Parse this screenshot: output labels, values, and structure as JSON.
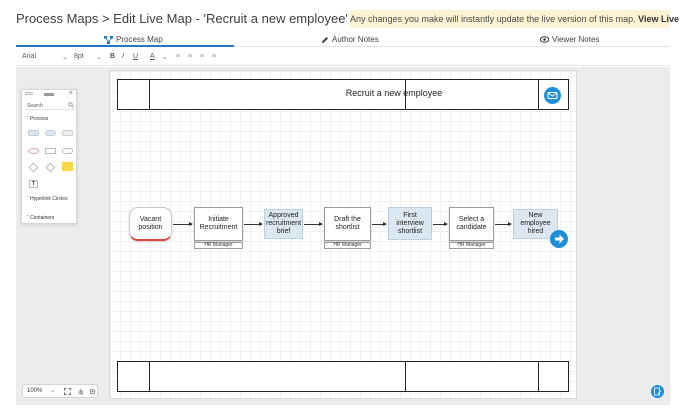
{
  "header": {
    "breadcrumb": "Process Maps > Edit Live Map - 'Recruit a new employee'",
    "notice_text": "Any changes you make will instantly update the live version of this map.",
    "notice_link": "View Live"
  },
  "tabs": [
    {
      "label": "Process Map",
      "icon": "sitemap-icon",
      "active": true
    },
    {
      "label": "Author Notes",
      "icon": "pencil-icon",
      "active": false
    },
    {
      "label": "Viewer Notes",
      "icon": "eye-icon",
      "active": false
    }
  ],
  "toolbar": {
    "font_family": "Arial",
    "font_size": "8pt",
    "bold": "B",
    "italic": "I",
    "underline": "U",
    "font_color": "A"
  },
  "palette": {
    "search_placeholder": "Search",
    "sections": [
      "Process",
      "Hyperlink Circles",
      "Containers"
    ],
    "text_tool": "T"
  },
  "map": {
    "title": "Recruit a new employee",
    "steps": [
      {
        "label": "Vacant position",
        "style": "start"
      },
      {
        "label": "Initiate Recruitment",
        "style": "white",
        "role": "HR Manager"
      },
      {
        "label": "Approved recruitment brief",
        "style": "blue"
      },
      {
        "label": "Draft the shortlist",
        "style": "white",
        "role": "HR Manager"
      },
      {
        "label": "First interview shortlist",
        "style": "blue"
      },
      {
        "label": "Select a candidate",
        "style": "white",
        "role": "HR Manager"
      },
      {
        "label": "New employee hired",
        "style": "blue"
      }
    ]
  },
  "zoom": {
    "level": "100%"
  },
  "colors": {
    "accent": "#1e8fd6",
    "notice_bg": "#fdf3d2",
    "start_marker": "#d9473b"
  }
}
